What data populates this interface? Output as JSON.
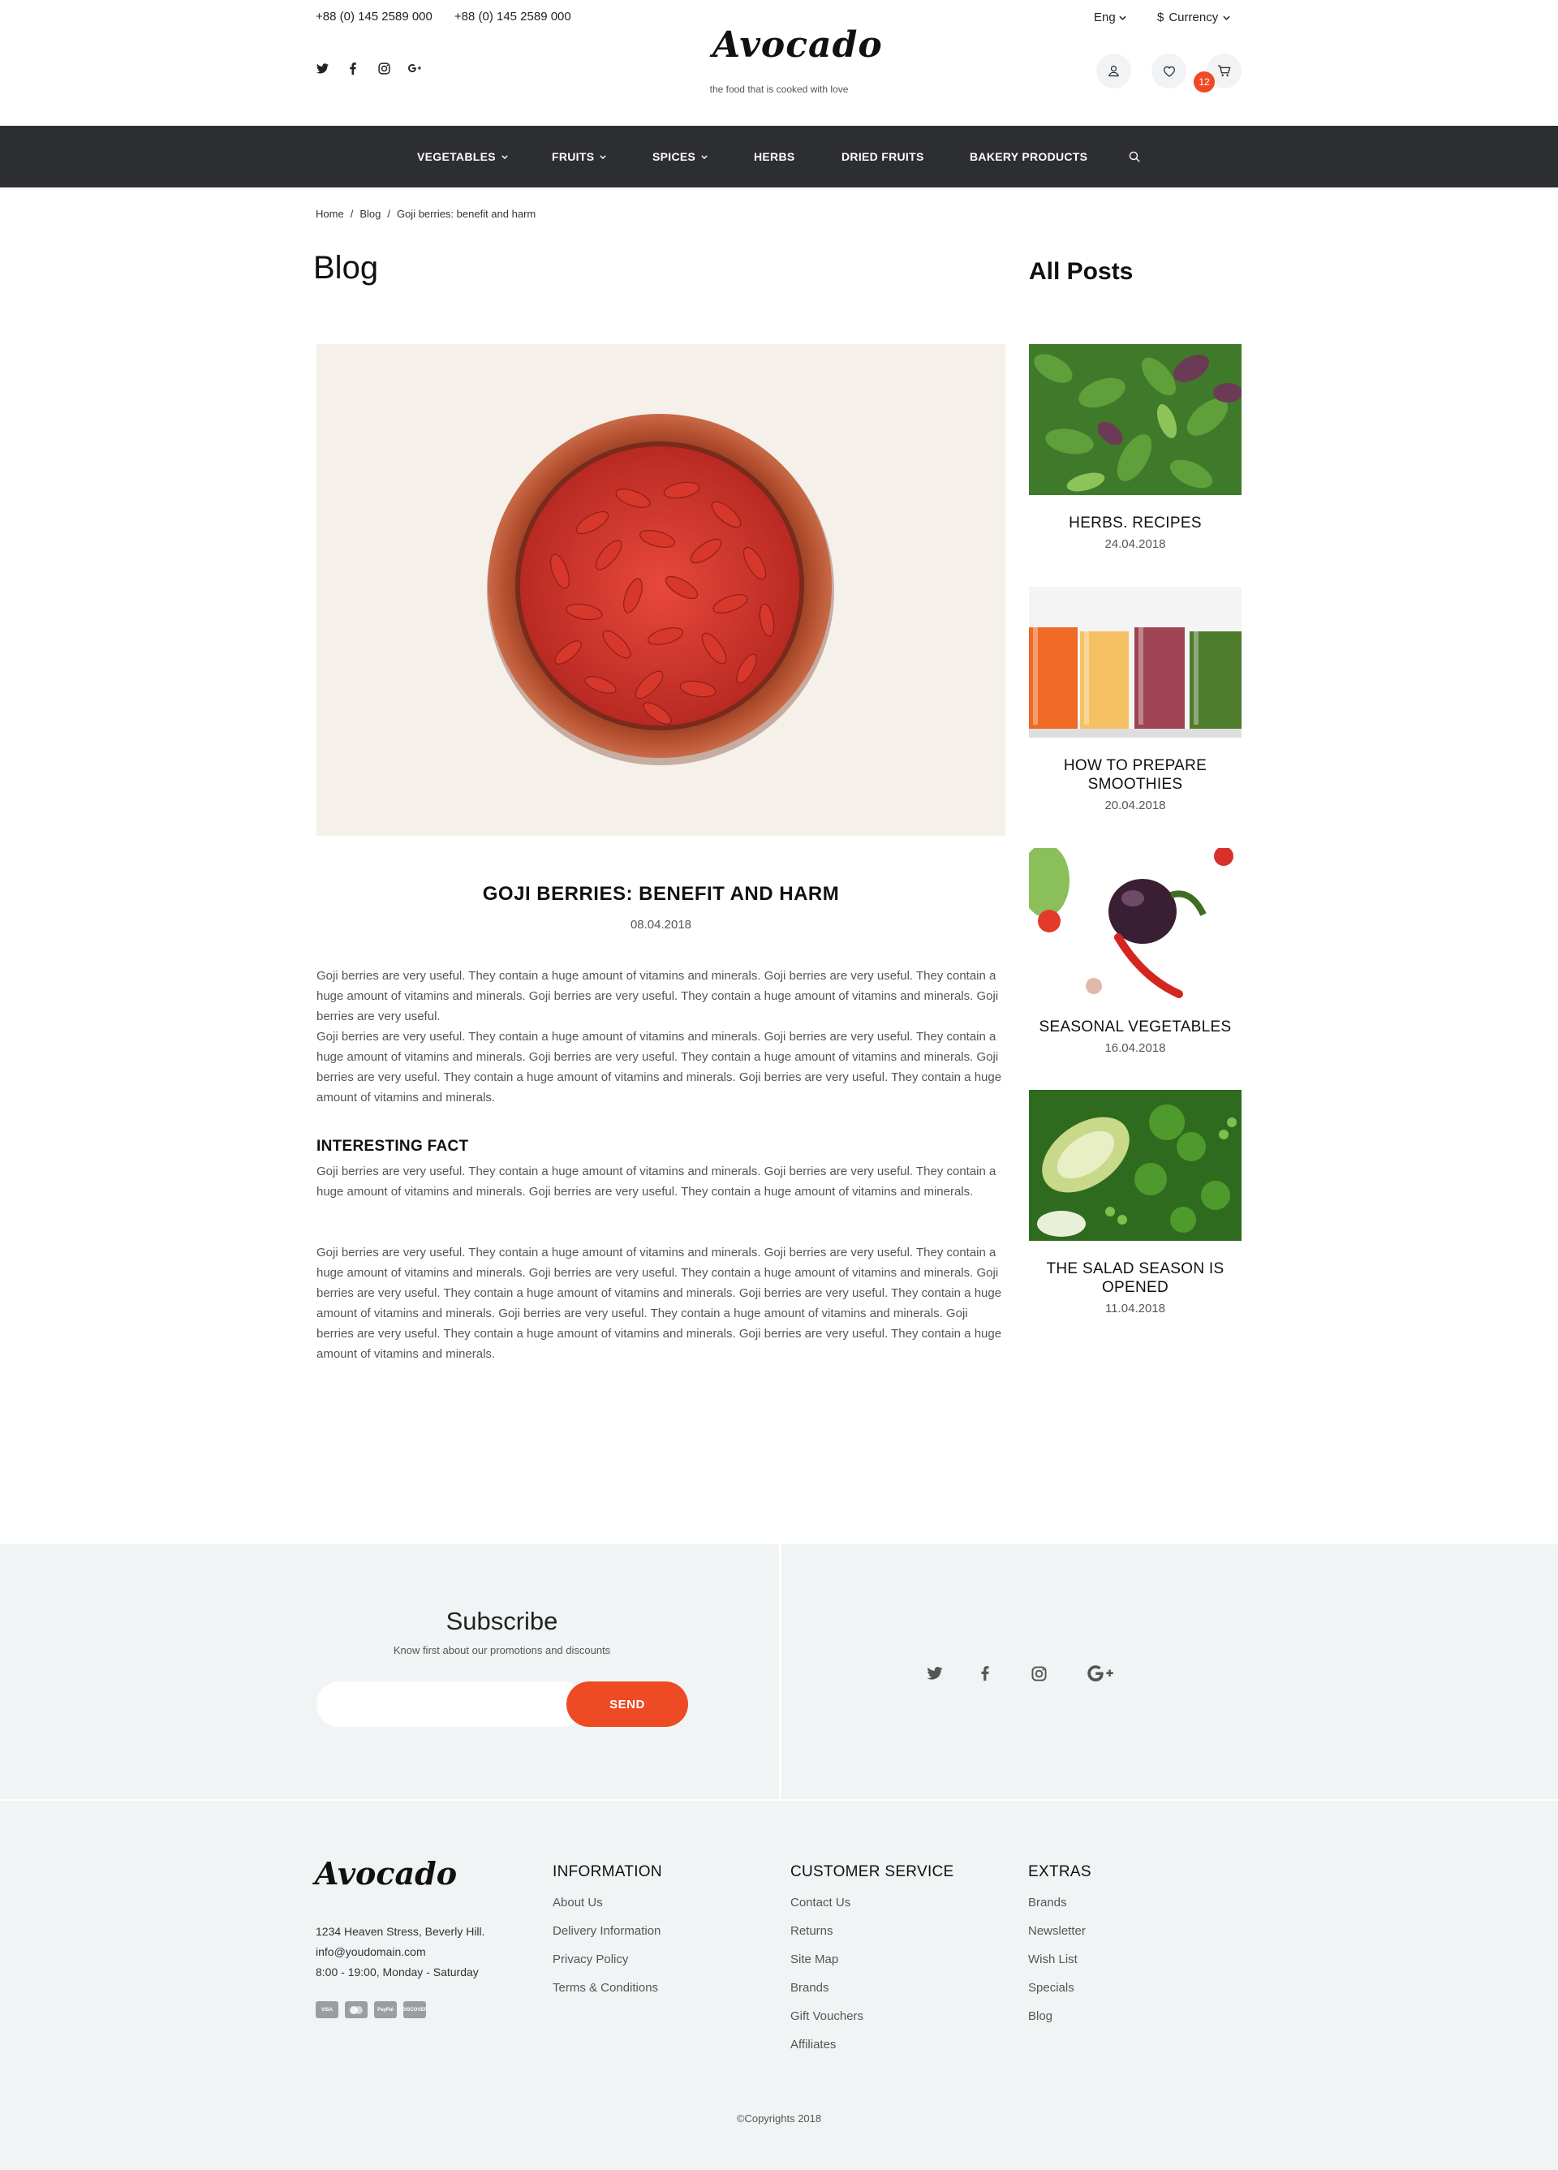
{
  "header": {
    "phones": [
      "+88 (0) 145 2589 000",
      "+88 (0) 145 2589 000"
    ],
    "logo": "Avocado",
    "tagline": "the food that is cooked with love",
    "language": "Eng",
    "currency_symbol": "$",
    "currency_label": "Currency",
    "cart_count": "12",
    "social_icons": [
      "twitter-icon",
      "facebook-icon",
      "instagram-icon",
      "google-plus-icon"
    ]
  },
  "nav": {
    "items": [
      {
        "label": "VEGETABLES",
        "dropdown": true
      },
      {
        "label": "FRUITS",
        "dropdown": true
      },
      {
        "label": "SPICES",
        "dropdown": true
      },
      {
        "label": "HERBS",
        "dropdown": false
      },
      {
        "label": "DRIED FRUITS",
        "dropdown": false
      },
      {
        "label": "BAKERY PRODUCTS",
        "dropdown": false
      }
    ]
  },
  "breadcrumb": {
    "items": [
      "Home",
      "Blog",
      "Goji berries: benefit and harm"
    ],
    "separator": "/"
  },
  "page": {
    "title": "Blog",
    "sidebar_title": "All Posts"
  },
  "post": {
    "title": "GOJI BERRIES: BENEFIT AND HARM",
    "date": "08.04.2018",
    "paragraph_1": "Goji berries are very useful. They contain a huge amount of vitamins and minerals. Goji berries are very useful. They contain a huge amount of vitamins and minerals. Goji berries are very useful. They contain a huge amount of vitamins and minerals. Goji berries are very useful.",
    "paragraph_2": "Goji berries are very useful. They contain a huge amount of vitamins and minerals. Goji berries are very useful. They contain a huge amount of vitamins and minerals. Goji berries are very useful. They contain a huge amount of vitamins and minerals. Goji berries are very useful. They contain a huge amount of vitamins and minerals. Goji berries are very useful. They contain a huge amount of vitamins and minerals.",
    "fact_heading": "INTERESTING FACT",
    "paragraph_3": "Goji berries are very useful. They contain a huge amount of vitamins and minerals. Goji berries are very useful. They contain a huge amount of vitamins and minerals. Goji berries are very useful. They contain a huge amount of vitamins and minerals.",
    "paragraph_4": "Goji berries are very useful. They contain a huge amount of vitamins and minerals. Goji berries are very useful. They contain a huge amount of vitamins and minerals. Goji berries are very useful. They contain a huge amount of vitamins and minerals. Goji berries are very useful. They contain a huge amount of vitamins and minerals. Goji berries are very useful. They contain a huge amount of vitamins and minerals. Goji berries are very useful. They contain a huge amount of vitamins and minerals. Goji berries are very useful. They contain a huge amount of vitamins and minerals. Goji berries are very useful. They contain a huge amount of vitamins and minerals."
  },
  "sidebar_posts": [
    {
      "title": "HERBS. RECIPES",
      "date": "24.04.2018"
    },
    {
      "title": "HOW TO PREPARE SMOOTHIES",
      "date": "20.04.2018"
    },
    {
      "title": "SEASONAL VEGETABLES",
      "date": "16.04.2018"
    },
    {
      "title": "THE SALAD SEASON IS OPENED",
      "date": "11.04.2018"
    }
  ],
  "subscribe": {
    "title": "Subscribe",
    "text": "Know first about our promotions and discounts",
    "input_placeholder": "",
    "button_label": "SEND"
  },
  "footer": {
    "logo": "Avocado",
    "address": "1234 Heaven Stress, Beverly Hill.",
    "email": "info@youdomain.com",
    "hours": "8:00 - 19:00, Monday - Saturday",
    "payment_cards": [
      "VISA",
      "MasterCard",
      "PayPal",
      "DISCOVER"
    ],
    "columns": [
      {
        "title": "INFORMATION",
        "links": [
          "About Us",
          "Delivery Information",
          "Privacy Policy",
          "Terms & Conditions"
        ]
      },
      {
        "title": "CUSTOMER SERVICE",
        "links": [
          "Contact Us",
          "Returns",
          "Site Map",
          "Brands",
          "Gift Vouchers",
          "Affiliates"
        ]
      },
      {
        "title": "EXTRAS",
        "links": [
          "Brands",
          "Newsletter",
          "Wish List",
          "Specials",
          "Blog"
        ]
      }
    ],
    "copyright": "©Copyrights 2018"
  },
  "colors": {
    "accent": "#ee4b24",
    "nav_bg": "#2d2e31",
    "band_bg": "#f1f4f5"
  }
}
